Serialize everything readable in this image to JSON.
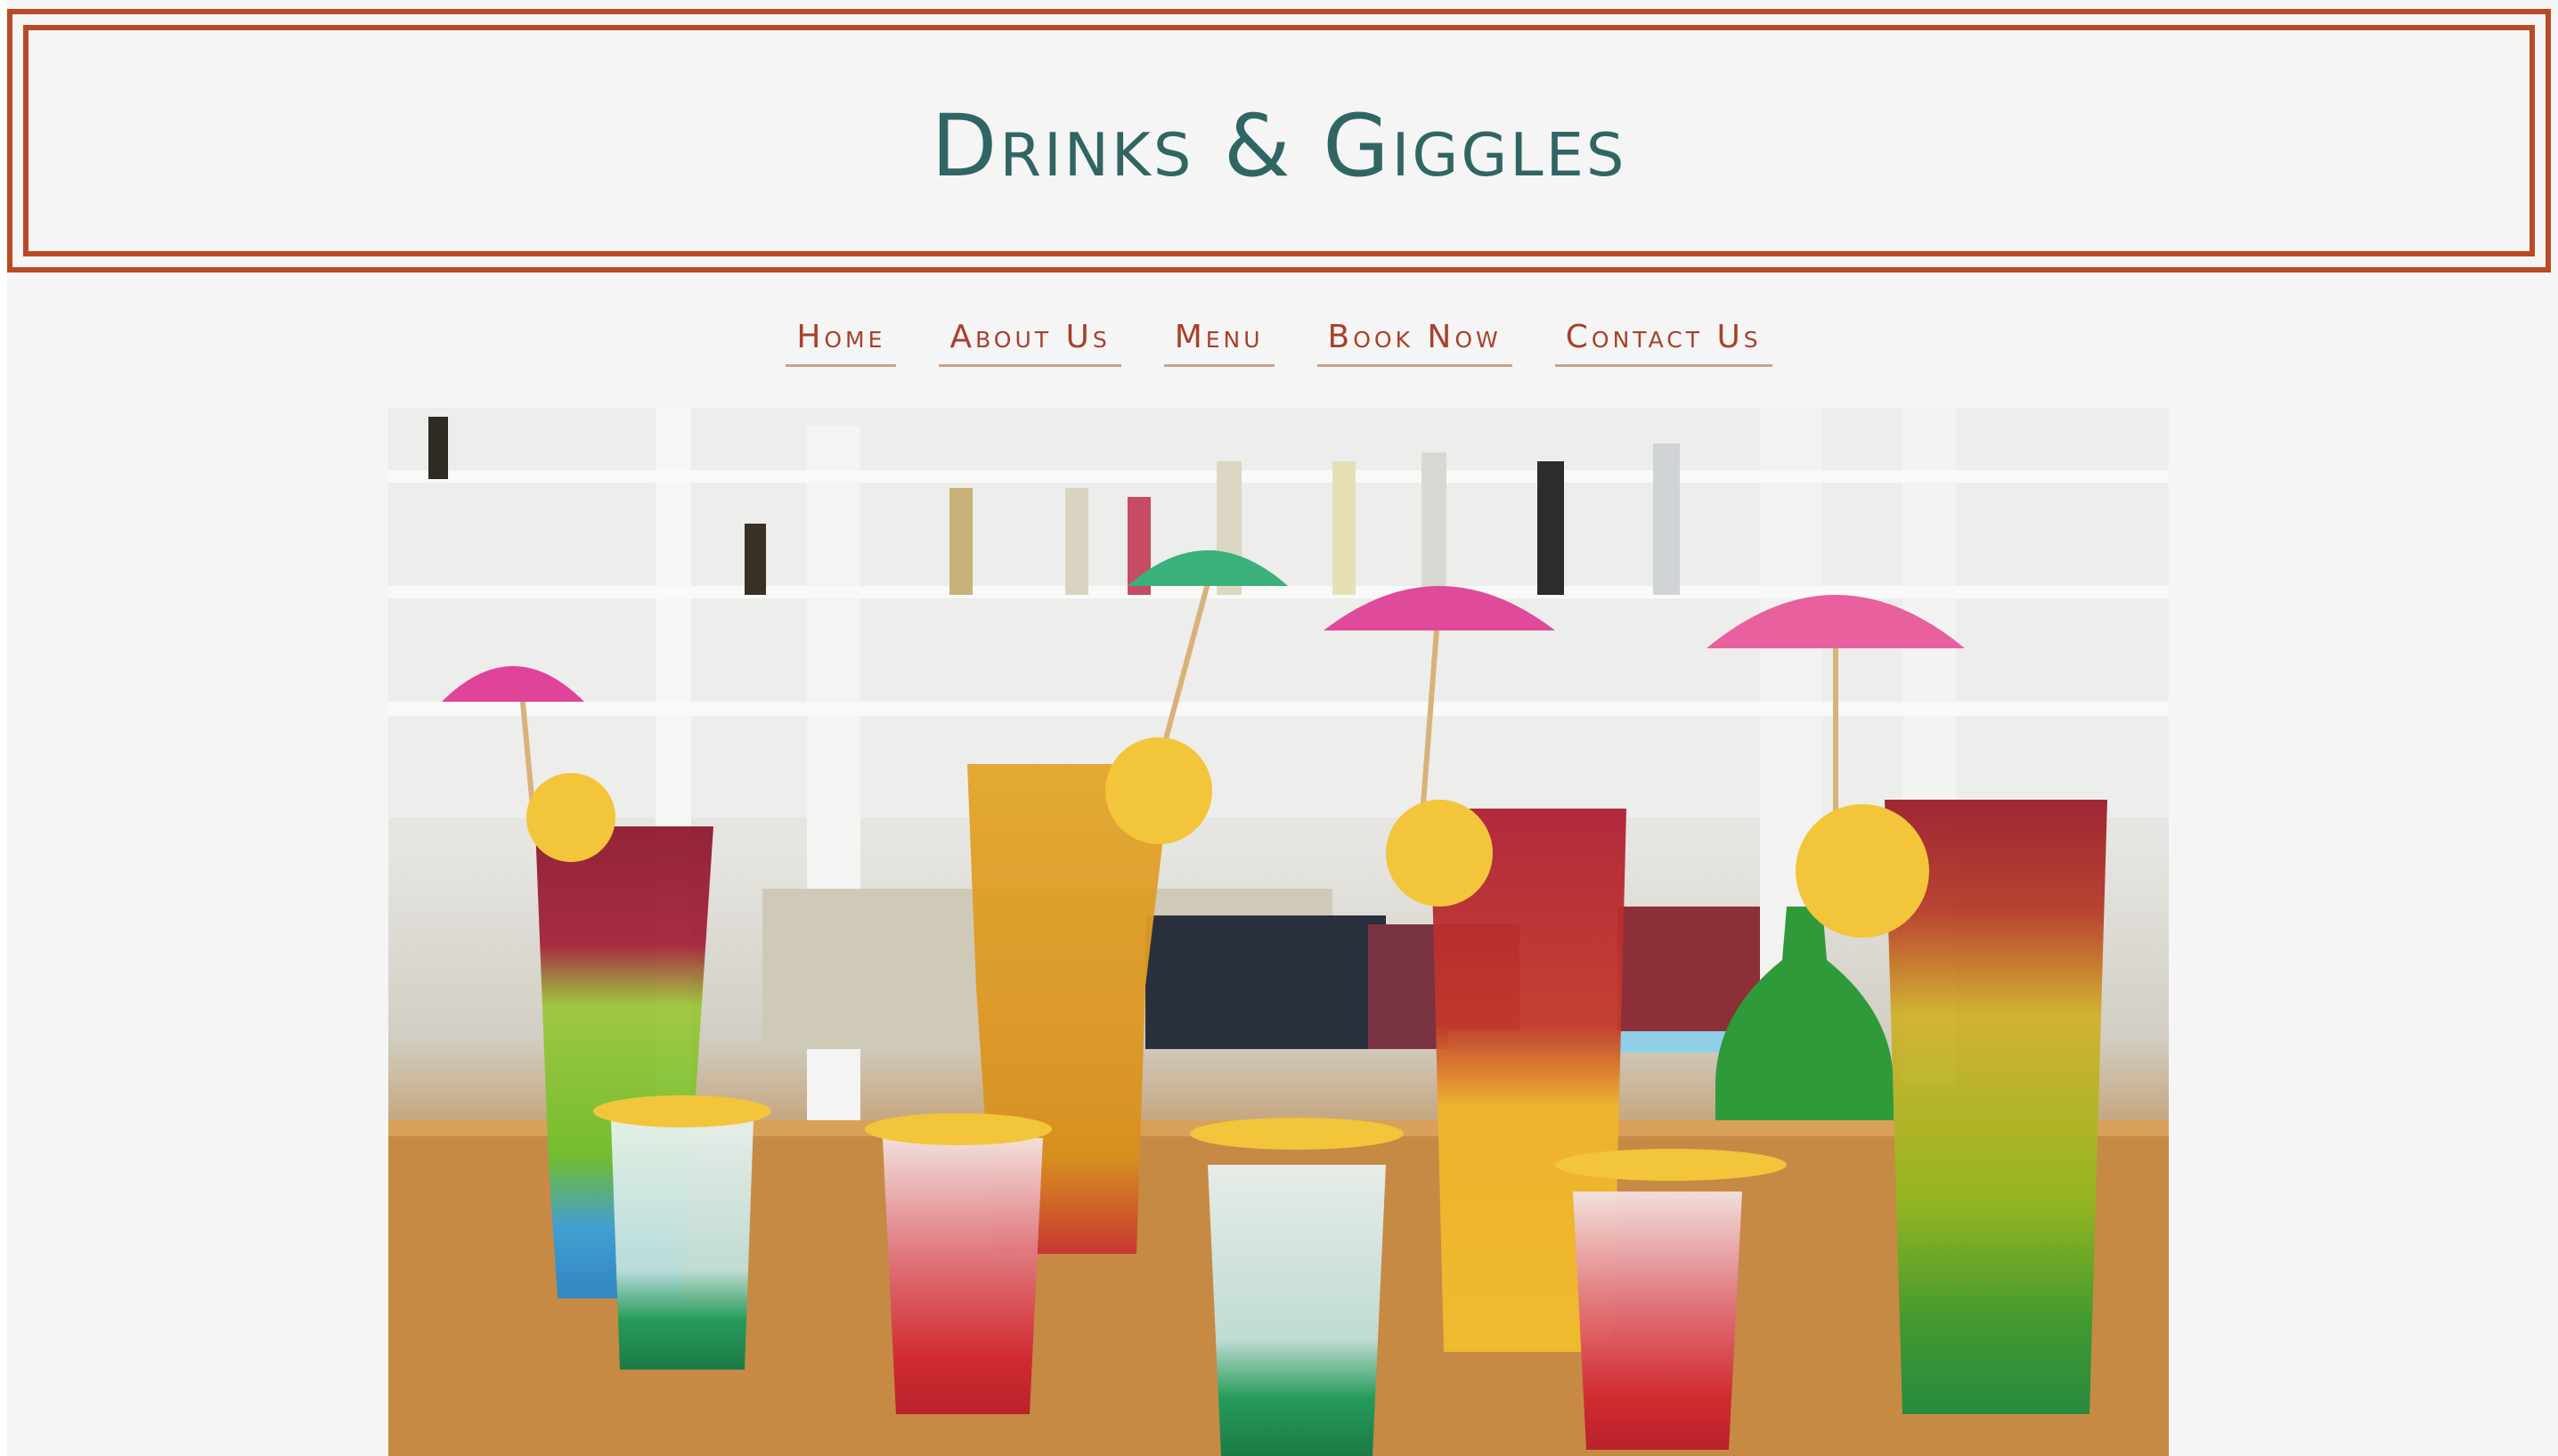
{
  "header": {
    "site_title": "Drinks & Giggles"
  },
  "nav": {
    "items": [
      {
        "label": "Home"
      },
      {
        "label": "About Us"
      },
      {
        "label": "Menu"
      },
      {
        "label": "Book Now"
      },
      {
        "label": "Contact Us"
      }
    ]
  },
  "hero": {
    "image": "photo of layered colorful cocktails with paper umbrellas and lemon slices on a wooden bar counter"
  },
  "colors": {
    "frame": "#b84a24",
    "title": "#2f6663",
    "nav_text": "#a8402a",
    "nav_underline": "#c9a38c",
    "background": "#f5f5f5"
  }
}
